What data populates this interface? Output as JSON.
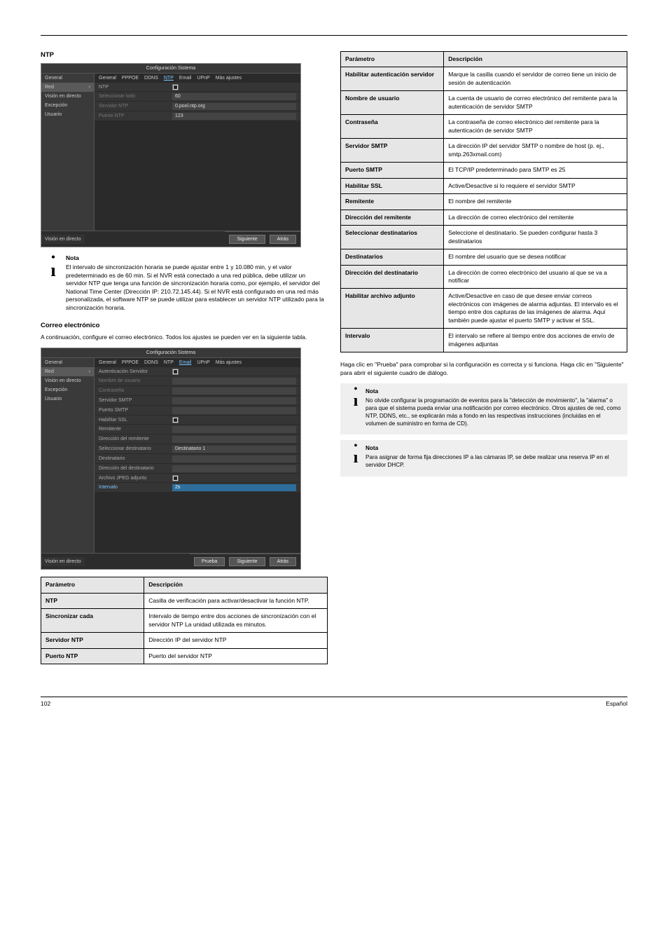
{
  "screenshot1": {
    "title": "Configuración Sistema",
    "sidebar": [
      "General",
      "Red",
      "Visión en directo",
      "Excepción",
      "Usuario"
    ],
    "sidebar_selected": "Red",
    "tabs": [
      "General",
      "PPPOE",
      "DDNS",
      "NTP",
      "Email",
      "UPnP",
      "Más ajustes"
    ],
    "tab_active": "NTP",
    "rows": [
      {
        "label": "NTP",
        "type": "checkbox",
        "checked": true
      },
      {
        "label": "Seleccionar todo",
        "value": "60",
        "muted": true
      },
      {
        "label": "Servidor NTP",
        "value": "0.pool.ntp.org",
        "muted": true
      },
      {
        "label": "Puerto NTP",
        "value": "123",
        "muted": true
      }
    ],
    "footer_left": "Visión en directo",
    "buttons": [
      "Siguiente",
      "Atrás"
    ]
  },
  "ntp_section_title": "NTP",
  "note1": {
    "head": "Nota",
    "body": "El intervalo de sincronización horaria se puede ajustar entre 1 y 10.080 min, y el valor predeterminado es de 60 min. Si el NVR está conectado a una red pública, debe utilizar un servidor NTP que tenga una función de sincronización horaria como, por ejemplo, el servidor del National Time Center (Dirección IP: 210.72.145.44). Si el NVR está configurado en una red más personalizada, el software NTP se puede utilizar para establecer un servidor NTP utilizado para la sincronización horaria."
  },
  "email_table": {
    "headers": [
      "Parámetro",
      "Descripción"
    ],
    "rows": [
      [
        "Habilitar autenticación servidor",
        "Marque la casilla cuando el servidor de correo tiene un inicio de sesión de autenticación"
      ],
      [
        "Nombre de usuario",
        "La cuenta de usuario de correo electrónico del remitente para la autenticación de servidor SMTP"
      ],
      [
        "Contraseña",
        "La contraseña de correo electrónico del remitente para la autenticación de servidor SMTP"
      ],
      [
        "Servidor SMTP",
        "La dirección IP del servidor SMTP o nombre de host (p. ej., smtp.263xmail.com)"
      ],
      [
        "Puerto SMTP",
        "El TCP/IP predeterminado para SMTP es 25"
      ],
      [
        "Habilitar SSL",
        "Active/Desactive si lo requiere el servidor SMTP"
      ],
      [
        "Remitente",
        "El nombre del remitente"
      ],
      [
        "Dirección del remitente",
        "La dirección de correo electrónico del remitente"
      ],
      [
        "Seleccionar destinatarios",
        "Seleccione el destinatario. Se pueden configurar hasta 3 destinatarios"
      ],
      [
        "Destinatarios",
        "El nombre del usuario que se desea notificar"
      ],
      [
        "Dirección del destinatario",
        "La dirección de correo electrónico del usuario al que se va a notificar"
      ],
      [
        "Habilitar archivo adjunto",
        "Active/Desactive en caso de que desee enviar correos electrónicos con imágenes de alarma adjuntas. El intervalo es el tiempo entre dos capturas de las imágenes de alarma. Aquí también puede ajustar el puerto SMTP y activar el SSL."
      ],
      [
        "Intervalo",
        "El intervalo se refiere al tiempo entre dos acciones de envío de imágenes adjuntas"
      ]
    ]
  },
  "email_section_title": "Correo electrónico",
  "email_intro": "A continuación, configure el correo electrónico. Todos los ajustes se pueden ver en la siguiente tabla.",
  "screenshot2": {
    "title": "Configuración Sistema",
    "sidebar": [
      "General",
      "Red",
      "Visión en directo",
      "Excepción",
      "Usuario"
    ],
    "sidebar_selected": "Red",
    "tabs": [
      "General",
      "PPPOE",
      "DDNS",
      "NTP",
      "Email",
      "UPnP",
      "Más ajustes"
    ],
    "tab_active": "Email",
    "rows": [
      {
        "label": "Autenticación Servidor",
        "type": "checkbox",
        "checked": true
      },
      {
        "label": "Nombre de usuario",
        "value": "",
        "muted": true
      },
      {
        "label": "Contraseña",
        "value": "",
        "muted": true
      },
      {
        "label": "Servidor SMTP",
        "value": ""
      },
      {
        "label": "Puerto SMTP",
        "value": ""
      },
      {
        "label": "Habilitar SSL",
        "type": "checkbox",
        "checked": true
      },
      {
        "label": "Remitente",
        "value": ""
      },
      {
        "label": "Dirección del remitente",
        "value": ""
      },
      {
        "label": "Seleccionar destinatario",
        "value": "Destinatario 1"
      },
      {
        "label": "Destinatario",
        "value": ""
      },
      {
        "label": "Dirección del destinatario",
        "value": ""
      },
      {
        "label": "Archivo JPEG adjunto",
        "type": "checkbox",
        "checked": true
      },
      {
        "label": "Intervalo",
        "value": "2s",
        "accent": true
      }
    ],
    "footer_left": "Visión en directo",
    "buttons": [
      "Prueba",
      "Siguiente",
      "Atrás"
    ]
  },
  "test_para": "Haga clic en \"Prueba\" para comprobar si la configuración es correcta y si funciona. Haga clic en \"Siguiente\" para abrir el siguiente cuadro de diálogo.",
  "note2": {
    "head": "Nota",
    "body": "No olvide configurar la programación de eventos para la \"detección de movimiento\", la \"alarma\" o para que el sistema pueda enviar una notificación por correo electrónico. Otros ajustes de red, como NTP, DDNS, etc., se explicarán más a fondo en las respectivas instrucciones (incluidas en el volumen de suministro en forma de CD)."
  },
  "note3": {
    "head": "Nota",
    "body": "Para asignar de forma fija direcciones IP a las cámaras IP, se debe realizar una reserva IP en el servidor DHCP."
  },
  "leftTable": {
    "headers": [
      "Parámetro",
      "Descripción"
    ],
    "rows": [
      [
        "NTP",
        "Casilla de verificación para activar/desactivar la función NTP."
      ],
      [
        "Sincronizar cada",
        "Intervalo de tiempo entre dos acciones de sincronización con el servidor NTP La unidad utilizada es minutos."
      ],
      [
        "Servidor NTP",
        "Dirección IP del servidor NTP"
      ],
      [
        "Puerto NTP",
        "Puerto del servidor NTP"
      ]
    ]
  },
  "footer": {
    "left": "102",
    "right": "Español"
  }
}
